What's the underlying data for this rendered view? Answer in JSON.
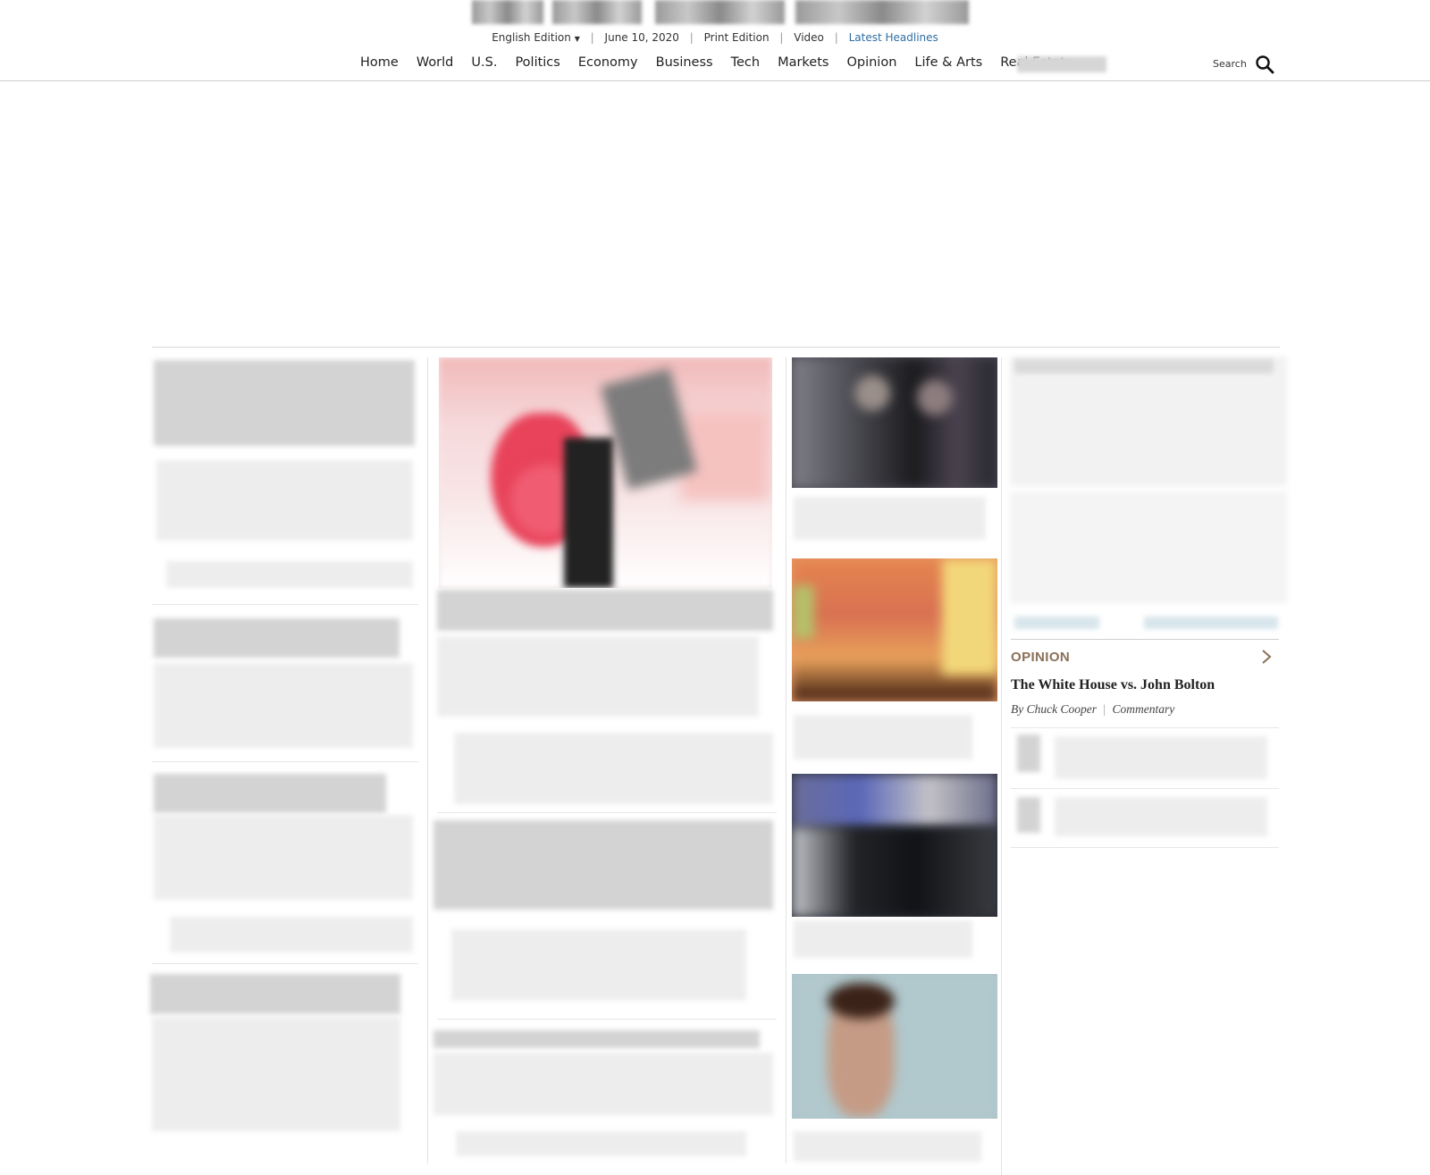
{
  "masthead": {
    "edition_label": "English Edition",
    "edition_caret": "▼",
    "date": "June 10, 2020",
    "print_edition": "Print Edition",
    "video": "Video",
    "latest_headlines": "Latest Headlines"
  },
  "nav": {
    "items": [
      "Home",
      "World",
      "U.S.",
      "Politics",
      "Economy",
      "Business",
      "Tech",
      "Markets",
      "Opinion",
      "Life & Arts",
      "Real Estate"
    ],
    "search_label": "Search"
  },
  "icons": {
    "search": "search-icon",
    "opinion_more": "chevron-right-icon"
  },
  "colors": {
    "opinion_accent": "#8a7058",
    "link_blue": "#2f6ea5",
    "rule": "#d8d8d8"
  },
  "opinion": {
    "section_label": "OPINION",
    "headline": "The White House vs. John Bolton",
    "author_prefix": "By",
    "author": "Chuck Cooper",
    "category": "Commentary"
  }
}
